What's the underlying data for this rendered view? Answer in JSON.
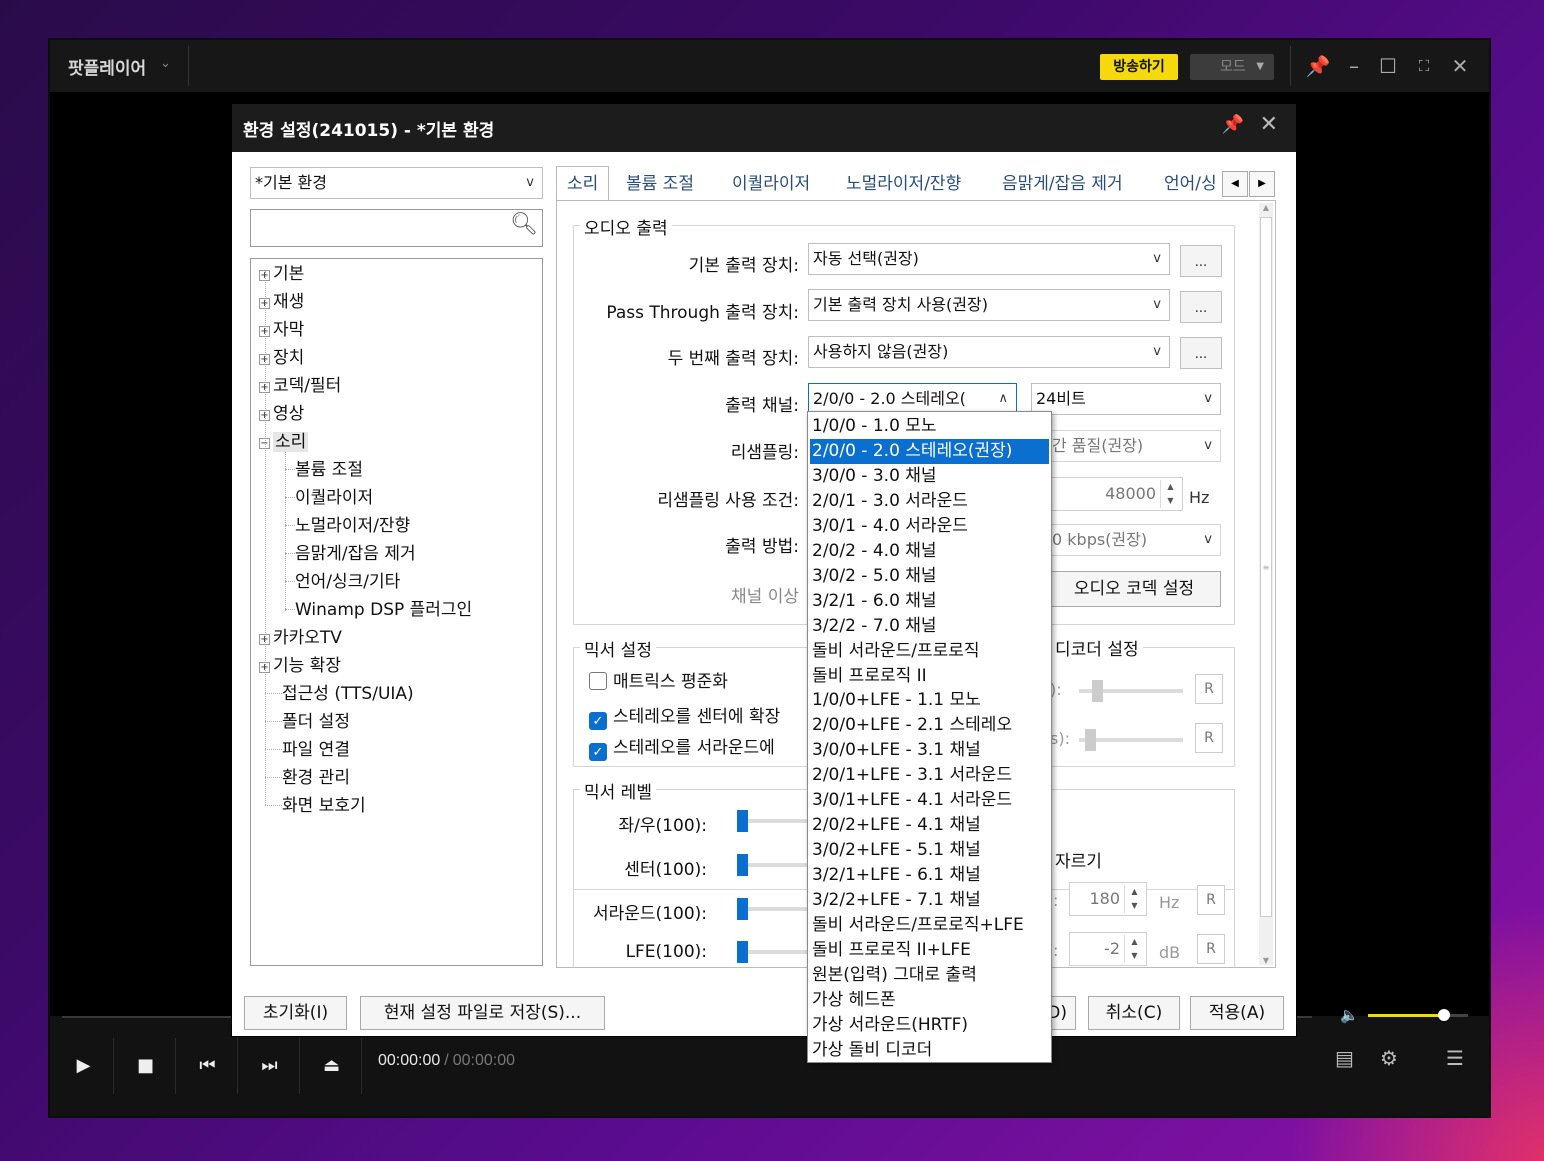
{
  "app": {
    "name": "팟플레이어",
    "broadcast_label": "방송하기",
    "mode_label": "모드",
    "accent": "#f5d90a"
  },
  "playback": {
    "current_time": "00:00:00",
    "sep": "/",
    "total_time": "00:00:00",
    "volume_level": 0.76
  },
  "dialog": {
    "title": "환경 설정(241015) - *기본 환경",
    "preset_value": "*기본 환경",
    "search_placeholder": "",
    "tree": [
      {
        "label": "기본",
        "expandable": true,
        "exp": "+"
      },
      {
        "label": "재생",
        "expandable": true,
        "exp": "+"
      },
      {
        "label": "자막",
        "expandable": true,
        "exp": "+"
      },
      {
        "label": "장치",
        "expandable": true,
        "exp": "+"
      },
      {
        "label": "코덱/필터",
        "expandable": true,
        "exp": "+"
      },
      {
        "label": "영상",
        "expandable": true,
        "exp": "+"
      },
      {
        "label": "소리",
        "expandable": true,
        "exp": "−"
      },
      {
        "label": "볼륨 조절",
        "child": true
      },
      {
        "label": "이퀄라이저",
        "child": true
      },
      {
        "label": "노멀라이저/잔향",
        "child": true
      },
      {
        "label": "음맑게/잡음 제거",
        "child": true
      },
      {
        "label": "언어/싱크/기타",
        "child": true
      },
      {
        "label": "Winamp DSP 플러그인",
        "child": true
      },
      {
        "label": "카카오TV",
        "expandable": true,
        "exp": "+"
      },
      {
        "label": "기능 확장",
        "expandable": true,
        "exp": "+"
      },
      {
        "label": "접근성 (TTS/UIA)"
      },
      {
        "label": "폴더 설정"
      },
      {
        "label": "파일 연결"
      },
      {
        "label": "환경 관리"
      },
      {
        "label": "화면 보호기"
      }
    ],
    "tabs": [
      "소리",
      "볼륨 조절",
      "이퀄라이저",
      "노멀라이저/잔향",
      "음맑게/잡음 제거",
      "언어/싱"
    ],
    "audio_output": {
      "group_label": "오디오 출력",
      "default_device_label": "기본 출력 장치:",
      "default_device_value": "자동 선택(권장)",
      "passthrough_label": "Pass Through 출력 장치:",
      "passthrough_value": "기본 출력 장치 사용(권장)",
      "second_device_label": "두 번째 출력 장치:",
      "second_device_value": "사용하지 않음(권장)",
      "dots": "...",
      "channel_label": "출력 채널:",
      "channel_value": "2/0/0 - 2.0 스테레오(",
      "bits_value": "24비트",
      "resample_label": "리샘플링:",
      "resample_value": "간 품질(권장)",
      "resample_cond_label": "리샘플링 사용 조건:",
      "resample_hz": "48000",
      "hz": "Hz",
      "output_method_label": "출력 방법:",
      "output_method_value": "0 kbps(권장)",
      "channel_over_label": "채널 이상",
      "codec_btn": "오디오 코덱 설정"
    },
    "mixer": {
      "group_label": "믹서 설정",
      "matrix_label": "매트릭스 평준화",
      "center_label": "스테레오를 센터에 확장",
      "surround_label": "스테레오를 서라운드에",
      "decoder_group_label": "디코더 설정",
      "decoder_row1_suffix": "):",
      "decoder_row2_suffix": "s):",
      "r": "R"
    },
    "mixer_level": {
      "group_label": "믹서 레벨",
      "rows": [
        {
          "label": "좌/우(100):"
        },
        {
          "label": "센터(100):"
        },
        {
          "label": "서라운드(100):"
        },
        {
          "label": "LFE(100):"
        }
      ],
      "cut_label": "자르기",
      "cut_colon": ":",
      "freq_value": "180",
      "freq_unit": "Hz",
      "gain_value": "-2",
      "gain_unit": "dB"
    },
    "buttons": {
      "reset": "초기화(I)",
      "save_file": "현재 설정 파일로 저장(S)...",
      "ok_partial": "D)",
      "cancel": "취소(C)",
      "apply": "적용(A)"
    },
    "channel_options": [
      "1/0/0 - 1.0 모노",
      "2/0/0 - 2.0 스테레오(권장)",
      "3/0/0 - 3.0 채널",
      "2/0/1 - 3.0 서라운드",
      "3/0/1 - 4.0 서라운드",
      "2/0/2 - 4.0 채널",
      "3/0/2 - 5.0 채널",
      "3/2/1 - 6.0 채널",
      "3/2/2 - 7.0 채널",
      "돌비 서라운드/프로로직",
      "돌비 프로로직 II",
      "1/0/0+LFE - 1.1 모노",
      "2/0/0+LFE - 2.1 스테레오",
      "3/0/0+LFE - 3.1 채널",
      "2/0/1+LFE - 3.1 서라운드",
      "3/0/1+LFE - 4.1 서라운드",
      "2/0/2+LFE - 4.1 채널",
      "3/0/2+LFE - 5.1 채널",
      "3/2/1+LFE - 6.1 채널",
      "3/2/2+LFE - 7.1 채널",
      "돌비 서라운드/프로로직+LFE",
      "돌비 프로로직 II+LFE",
      "원본(입력) 그대로 출력",
      "가상 헤드폰",
      "가상 서라운드(HRTF)",
      "가상 돌비 디코더"
    ],
    "channel_selected_index": 1
  }
}
